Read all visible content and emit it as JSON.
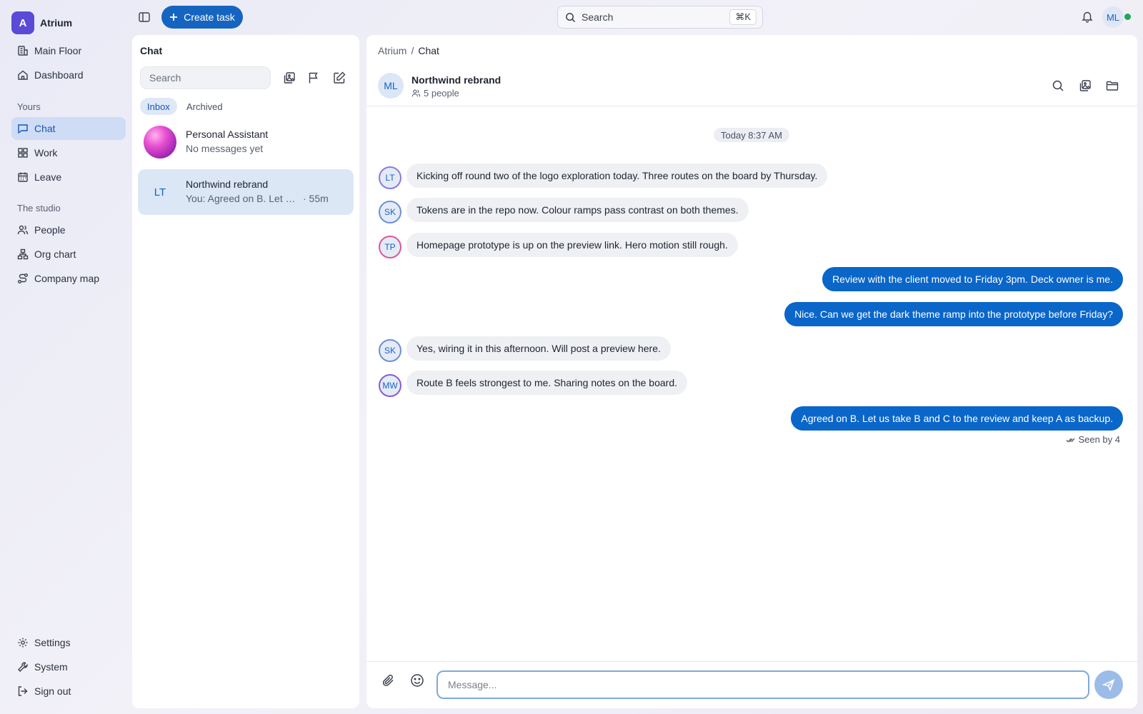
{
  "app": {
    "name": "Atrium",
    "logo_letter": "A",
    "accent": "#1565c0",
    "brand_color": "#5b4ad6"
  },
  "sidebar": {
    "top_items": [
      {
        "label": "Main Floor",
        "icon": "building-icon"
      },
      {
        "label": "Dashboard",
        "icon": "home-icon"
      }
    ],
    "yours_label": "Yours",
    "yours_items": [
      {
        "label": "Chat",
        "icon": "chat-icon",
        "active": true
      },
      {
        "label": "Work",
        "icon": "grid-icon"
      },
      {
        "label": "Leave",
        "icon": "calendar-icon"
      }
    ],
    "studio_label": "The studio",
    "studio_items": [
      {
        "label": "People",
        "icon": "users-icon"
      },
      {
        "label": "Org chart",
        "icon": "org-chart-icon"
      },
      {
        "label": "Company map",
        "icon": "route-icon"
      }
    ],
    "bottom_items": [
      {
        "label": "Settings",
        "icon": "gear-icon"
      },
      {
        "label": "System",
        "icon": "wrench-icon"
      },
      {
        "label": "Sign out",
        "icon": "sign-out-icon"
      }
    ]
  },
  "topbar": {
    "create_label": "Create task",
    "search_placeholder": "Search",
    "search_shortcut": "⌘K",
    "user_initials": "ML",
    "status_color": "#22a55a"
  },
  "chat_list": {
    "title": "Chat",
    "search_placeholder": "Search",
    "tabs": [
      {
        "label": "Inbox",
        "active": true
      },
      {
        "label": "Archived",
        "active": false
      }
    ],
    "conversations": [
      {
        "name": "Personal Assistant",
        "preview": "No messages yet",
        "time": ""
      },
      {
        "name": "Northwind rebrand",
        "initials": "LT",
        "preview": "You: Agreed on B. Let us take B and C to the review and keep A as backup.",
        "time": "· 55m",
        "active": true
      }
    ]
  },
  "conversation": {
    "breadcrumb": {
      "root": "Atrium",
      "sep": "/",
      "current": "Chat"
    },
    "group": {
      "initials": "ML",
      "name": "Northwind rebrand",
      "members": "5 people"
    },
    "day_label": "Today 8:37 AM",
    "messages": [
      {
        "from": "LT",
        "mine": false,
        "text": "Kicking off round two of the logo exploration today. Three routes on the board by Thursday."
      },
      {
        "from": "SK",
        "mine": false,
        "text": "Tokens are in the repo now. Colour ramps pass contrast on both themes."
      },
      {
        "from": "TP",
        "mine": false,
        "text": "Homepage prototype is up on the preview link. Hero motion still rough."
      },
      {
        "from": "",
        "mine": true,
        "text": "Review with the client moved to Friday 3pm. Deck owner is me."
      },
      {
        "from": "",
        "mine": true,
        "text": "Nice. Can we get the dark theme ramp into the prototype before Friday?"
      },
      {
        "from": "SK",
        "mine": false,
        "text": "Yes, wiring it in this afternoon. Will post a preview here."
      },
      {
        "from": "MW",
        "mine": false,
        "text": "Route B feels strongest to me. Sharing notes on the board."
      },
      {
        "from": "",
        "mine": true,
        "text": "Agreed on B. Let us take B and C to the review and keep A as backup."
      }
    ],
    "seen_label": "Seen by 4",
    "composer_placeholder": "Message..."
  }
}
